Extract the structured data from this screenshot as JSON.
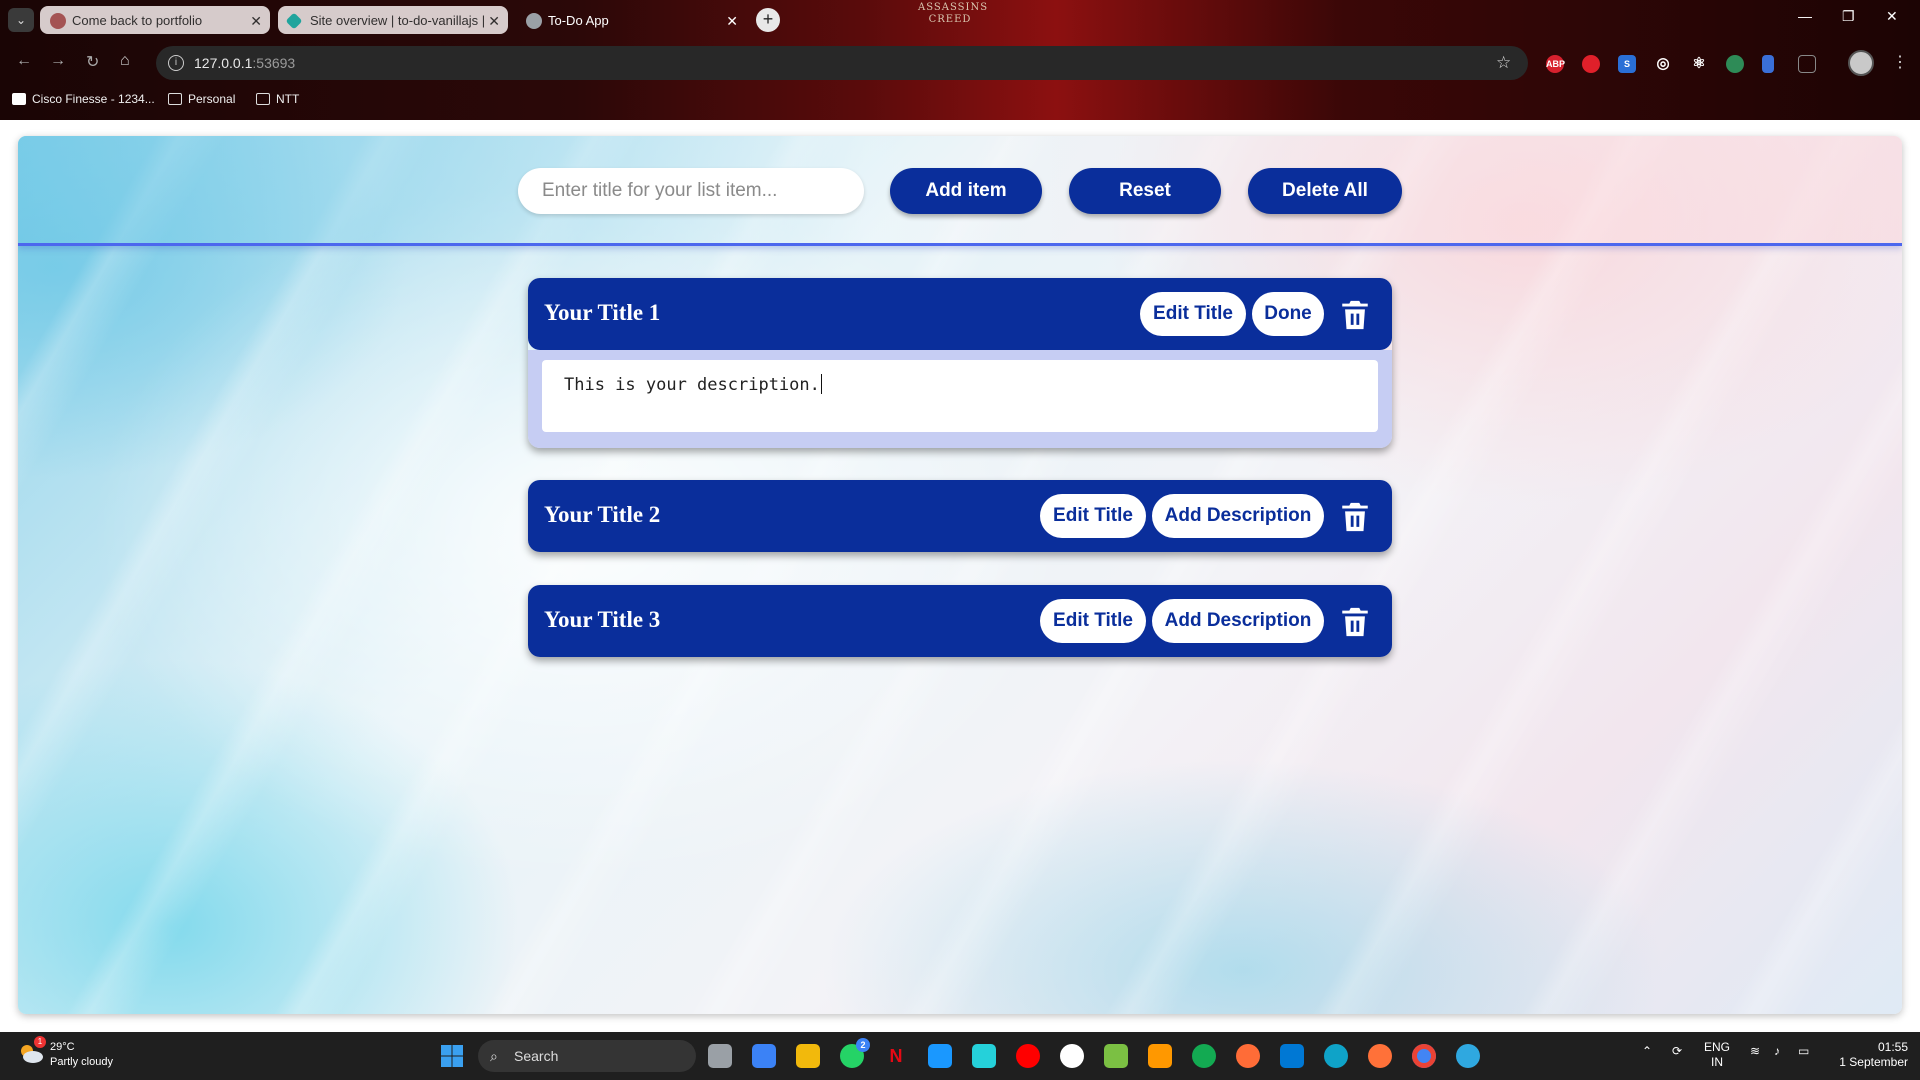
{
  "browser": {
    "tabs": [
      {
        "label": "Come back to portfolio",
        "favicon_color": "#b05a5a"
      },
      {
        "label": "Site overview | to-do-vanillajs |",
        "favicon_color": "#20b2aa"
      },
      {
        "label": "To-Do App",
        "favicon_color": "#9aa0a6"
      }
    ],
    "tab_close_glyph": "✕",
    "new_tab_glyph": "+",
    "header_logo": "ASSASSINS CREED",
    "url_host": "127.0.0.1",
    "url_port": ":53693",
    "bookmarks": [
      {
        "label": "Cisco Finesse - 1234..."
      },
      {
        "label": "Personal"
      },
      {
        "label": "NTT"
      }
    ],
    "extensions": [
      {
        "name": "adblock-plus-icon",
        "label": "ABP",
        "color": "#d7212e"
      },
      {
        "name": "stop-icon",
        "label": "",
        "color": "#e0202a"
      },
      {
        "name": "s-extension-icon",
        "label": "S",
        "color": "#2a6fd6"
      },
      {
        "name": "target-icon",
        "label": "◎",
        "color": "#666666"
      },
      {
        "name": "react-devtools-icon",
        "label": "⚛",
        "color": "#555555"
      },
      {
        "name": "globe-extension-icon",
        "label": "",
        "color": "#2e8b57"
      },
      {
        "name": "doc-extension-icon",
        "label": "",
        "color": "#3a6fd8"
      },
      {
        "name": "puzzle-icon",
        "label": "",
        "color": "#444444"
      }
    ]
  },
  "app": {
    "input_placeholder": "Enter title for your list item...",
    "add_label": "Add item",
    "reset_label": "Reset",
    "delete_all_label": "Delete All",
    "colors": {
      "primary": "#0a2e9b",
      "accent_line": "#4c67ee"
    },
    "items": [
      {
        "title": "Your Title 1",
        "edit_label": "Edit Title",
        "action_label": "Done",
        "description": "This is your description.",
        "expanded": true
      },
      {
        "title": "Your Title 2",
        "edit_label": "Edit Title",
        "action_label": "Add Description",
        "expanded": false
      },
      {
        "title": "Your Title 3",
        "edit_label": "Edit Title",
        "action_label": "Add Description",
        "expanded": false
      }
    ]
  },
  "taskbar": {
    "weather_temp": "29°C",
    "weather_desc": "Partly cloudy",
    "weather_badge": "1",
    "search_label": "Search",
    "whatsapp_badge": "2",
    "lang_1": "ENG",
    "lang_2": "IN",
    "time": "01:55",
    "date": "1 September"
  }
}
